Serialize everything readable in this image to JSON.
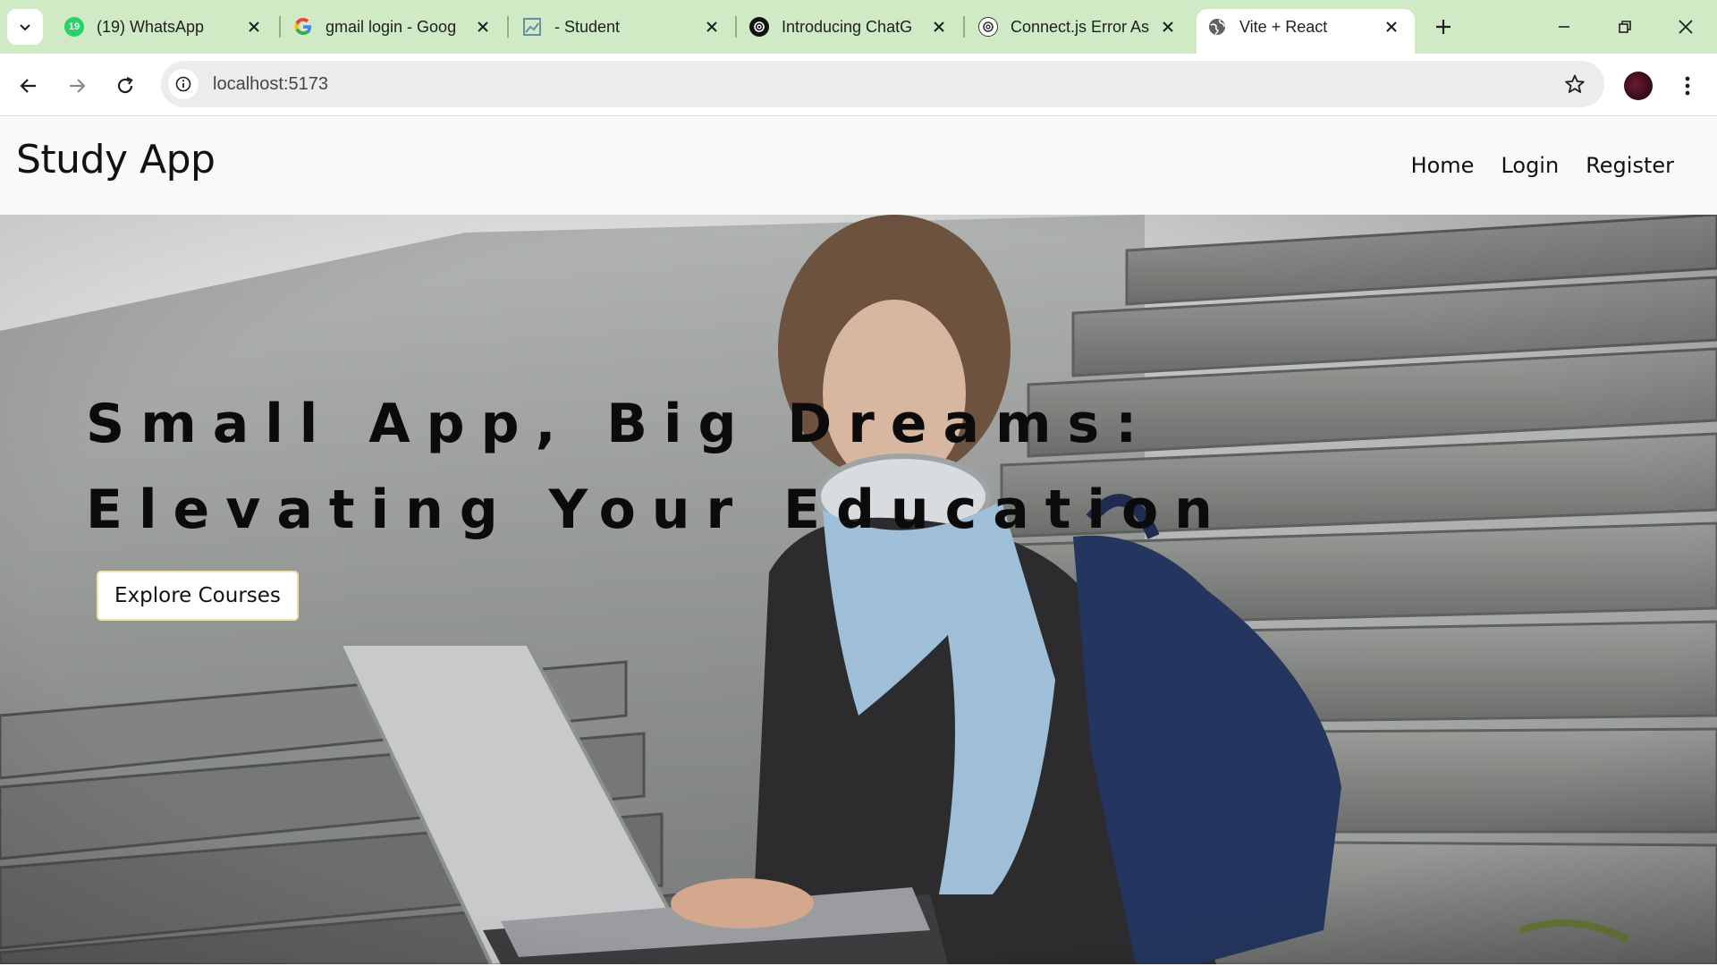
{
  "browser": {
    "tabs": [
      {
        "title": "(19) WhatsApp",
        "icon": "whatsapp-icon",
        "badge": "19"
      },
      {
        "title": "gmail login - Goog",
        "icon": "google-icon"
      },
      {
        "title": "- Student",
        "icon": "image-icon"
      },
      {
        "title": "Introducing ChatG",
        "icon": "chatgpt-icon"
      },
      {
        "title": "Connect.js Error As",
        "icon": "chatgpt-icon"
      },
      {
        "title": "Vite + React",
        "icon": "globe-icon",
        "active": true
      }
    ],
    "url": "localhost:5173",
    "colors": {
      "tabstrip": "#cfeac4",
      "toolbar": "#ffffff",
      "omnibox": "#ececec"
    }
  },
  "site": {
    "brand": "Study App",
    "nav": [
      {
        "label": "Home"
      },
      {
        "label": "Login"
      },
      {
        "label": "Register"
      }
    ],
    "hero": {
      "headline_line1": "Small App, Big Dreams:",
      "headline_line2": "Elevating Your Education",
      "cta_label": "Explore Courses",
      "image_description_icon": "student-laptop-photo"
    },
    "colors": {
      "navbar_bg": "#f8f9fa",
      "headline": "#0b0b0b",
      "cta_border": "#f0e3a8"
    }
  }
}
